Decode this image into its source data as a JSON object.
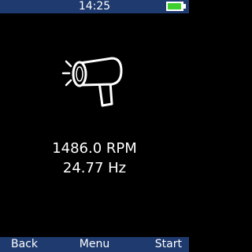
{
  "status_bar": {
    "time": "14:25",
    "battery_level": 0.95,
    "battery_color": "#3fcf2f",
    "background_color": "#1e3a6e"
  },
  "main": {
    "icon": "tachometer-icon",
    "rpm_reading": "1486.0 RPM",
    "hz_reading": "24.77 Hz"
  },
  "softkeys": {
    "left_label": "Back",
    "center_label": "Menu",
    "right_label": "Start"
  }
}
